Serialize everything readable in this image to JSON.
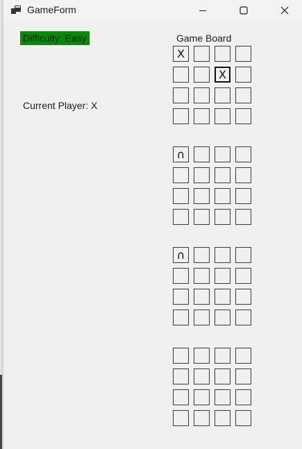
{
  "window": {
    "title": "GameForm",
    "icon": "app-window-icon",
    "controls": [
      "minimize-icon",
      "maximize-icon",
      "close-icon"
    ]
  },
  "difficulty": {
    "label": "Difficulty: Easy",
    "color": "#078a07"
  },
  "current_player": "Current Player: X",
  "board": {
    "label": "Game Board",
    "layers": [
      {
        "rows": [
          [
            "X",
            "",
            "",
            ""
          ],
          [
            "",
            "",
            "X",
            ""
          ],
          [
            "",
            "",
            "",
            ""
          ],
          [
            "",
            "",
            "",
            ""
          ]
        ]
      },
      {
        "rows": [
          [
            "∩",
            "",
            "",
            ""
          ],
          [
            "",
            "",
            "",
            ""
          ],
          [
            "",
            "",
            "",
            ""
          ],
          [
            "",
            "",
            "",
            ""
          ]
        ]
      },
      {
        "rows": [
          [
            "∩",
            "",
            "",
            ""
          ],
          [
            "",
            "",
            "",
            ""
          ],
          [
            "",
            "",
            "",
            ""
          ],
          [
            "",
            "",
            "",
            ""
          ]
        ]
      },
      {
        "rows": [
          [
            "",
            "",
            "",
            ""
          ],
          [
            "",
            "",
            "",
            ""
          ],
          [
            "",
            "",
            "",
            ""
          ],
          [
            "",
            "",
            "",
            ""
          ]
        ]
      }
    ],
    "focused_cell": {
      "layer": 0,
      "row": 1,
      "col": 2
    }
  }
}
